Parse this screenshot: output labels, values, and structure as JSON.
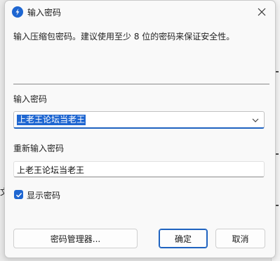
{
  "window": {
    "title": "输入密码",
    "description": "输入压缩包密码。建议使用至少 8 位的密码来保证安全性。"
  },
  "password": {
    "label": "输入密码",
    "value": "上老王论坛当老王"
  },
  "confirm": {
    "label": "重新输入密码",
    "value": "上老王论坛当老王"
  },
  "show_password": {
    "label": "显示密码",
    "checked": true
  },
  "buttons": {
    "manager": "密码管理器...",
    "ok": "确定",
    "cancel": "取消"
  },
  "background": {
    "left_fragment": "文"
  },
  "colors": {
    "accent": "#1e66d1",
    "dialog_bg": "#f9f9f9"
  },
  "icons": {
    "app": "bandizip-app-icon",
    "close": "close-icon",
    "dropdown": "chevron-down-icon",
    "check": "checkmark-icon"
  }
}
